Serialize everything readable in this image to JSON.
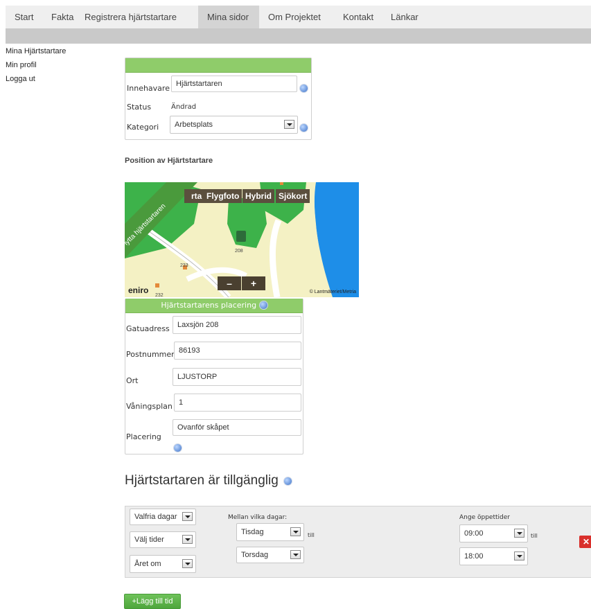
{
  "nav": {
    "items": [
      "Start",
      "Fakta",
      "Registrera hjärtstartare",
      "Mina sidor",
      "Om Projektet",
      "Kontakt",
      "Länkar"
    ],
    "active_index": 3
  },
  "sidebar": {
    "items": [
      "Mina Hjärtstartare",
      "Min profil",
      "Logga ut"
    ]
  },
  "owner_box": {
    "owner_label": "Innehavare",
    "owner_value": "Hjärtstartaren",
    "status_label": "Status",
    "status_value": "Ändrad",
    "category_label": "Kategori",
    "category_value": "Arbetsplats"
  },
  "position": {
    "heading": "Position av Hjärtstartare"
  },
  "map": {
    "tabs": [
      "rta",
      "Flygfoto",
      "Hybrid",
      "Sjökort"
    ],
    "ribbon": "Flytta hjärtstartaren",
    "zoom_out": "–",
    "zoom_in": "+",
    "logo": "eniro",
    "copyright": "© Lantmäteriet/Metria",
    "labels": [
      "208",
      "233",
      "232"
    ]
  },
  "placement": {
    "title": "Hjärtstartarens placering",
    "street_label": "Gatuadress",
    "street_value": "Laxsjön 208",
    "zip_label": "Postnummer",
    "zip_value": "86193",
    "city_label": "Ort",
    "city_value": "LJUSTORP",
    "floor_label": "Våningsplan",
    "floor_value": "1",
    "place_label": "Placering",
    "place_value": "Ovanför skåpet"
  },
  "availability": {
    "heading": "Hjärtstartaren är tillgänglig",
    "days_select": "Valfria dagar",
    "times_select": "Välj tider",
    "year_select": "Året om",
    "between_days_label": "Mellan vilka dagar:",
    "day_from": "Tisdag",
    "till1": "till",
    "day_to": "Torsdag",
    "hours_label": "Ange öppettider",
    "time_from": "09:00",
    "till2": "till",
    "time_to": "18:00",
    "add_button": "+Lägg till tid"
  },
  "colors": {
    "accent_green": "#8fcc6a",
    "button_green": "#4ea63c",
    "delete_red": "#d9302c"
  }
}
